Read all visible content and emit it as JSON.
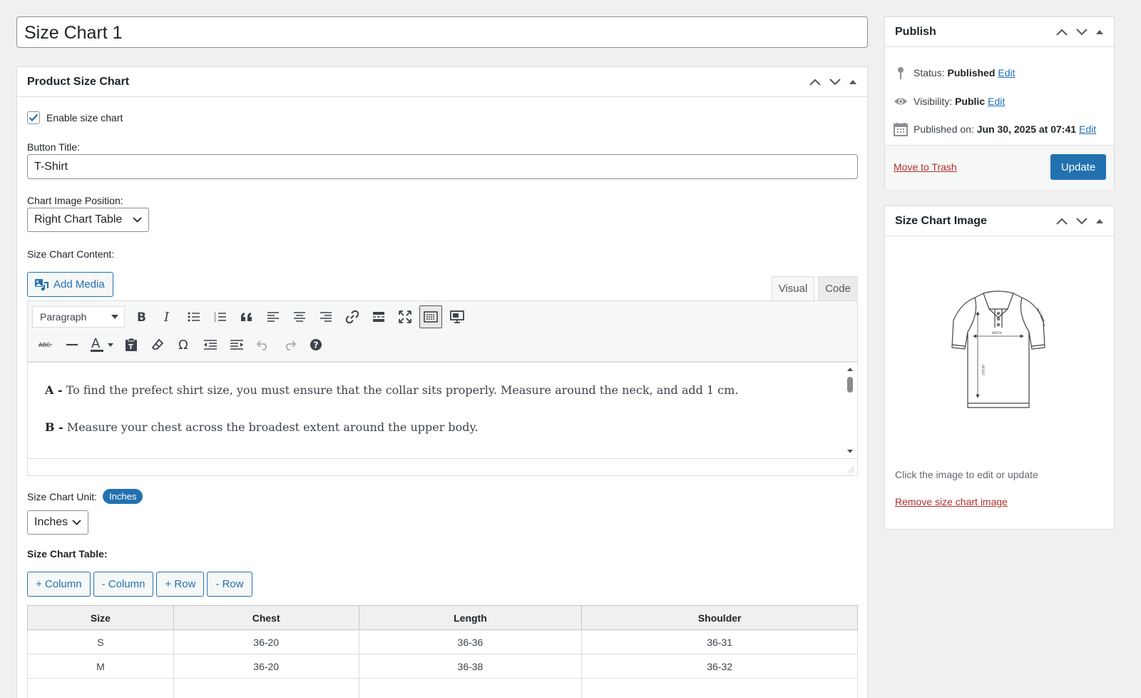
{
  "post_title": "Size Chart 1",
  "main_box": {
    "title": "Product Size Chart",
    "enable_label": "Enable size chart",
    "enable_checked": true,
    "button_title_label": "Button Title:",
    "button_title_value": "T-Shirt",
    "image_position_label": "Chart Image Position:",
    "image_position_value": "Right Chart Table",
    "content_label": "Size Chart Content:",
    "add_media_label": "Add Media",
    "tab_visual": "Visual",
    "tab_code": "Code",
    "format_select": "Paragraph",
    "content_paragraphs": [
      {
        "lead": "A -",
        "text": " To find the prefect shirt size, you must ensure that the collar sits properly. Measure around the neck, and add 1 cm."
      },
      {
        "lead": "B -",
        "text": " Measure your chest across the broadest extent around the upper body."
      }
    ],
    "unit_label": "Size Chart Unit:",
    "unit_badge": "Inches",
    "unit_select": "Inches",
    "table_label": "Size Chart Table:",
    "table_buttons": [
      "+ Column",
      "- Column",
      "+ Row",
      "- Row"
    ],
    "table": {
      "headers": [
        "Size",
        "Chest",
        "Length",
        "Shoulder"
      ],
      "rows": [
        [
          "S",
          "36-20",
          "36-36",
          "36-31"
        ],
        [
          "M",
          "36-20",
          "36-38",
          "36-32"
        ],
        [
          "",
          "",
          "",
          ""
        ]
      ]
    }
  },
  "publish_box": {
    "title": "Publish",
    "status_label": "Status:",
    "status_value": "Published",
    "visibility_label": "Visibility:",
    "visibility_value": "Public",
    "published_label": "Published on:",
    "published_value": "Jun 30, 2025 at 07:41",
    "edit_link": "Edit",
    "trash_link": "Move to Trash",
    "update_button": "Update"
  },
  "image_box": {
    "title": "Size Chart Image",
    "hint": "Click the image to edit or update",
    "remove_link": "Remove size chart image"
  },
  "toolbar_icons": {
    "row1": [
      "bold-icon",
      "italic-icon",
      "bullet-list-icon",
      "numbered-list-icon",
      "blockquote-icon",
      "align-left-icon",
      "align-center-icon",
      "align-right-icon",
      "link-icon",
      "read-more-icon",
      "fullscreen-icon",
      "toolbar-toggle-icon",
      "preview-icon"
    ],
    "row2": [
      "strikethrough-icon",
      "horizontal-line-icon",
      "text-color-icon",
      "paste-text-icon",
      "clear-formatting-icon",
      "special-character-icon",
      "outdent-icon",
      "indent-icon",
      "undo-icon",
      "redo-icon",
      "help-icon"
    ]
  },
  "colors": {
    "accent": "#2271b1",
    "danger": "#b32d2e",
    "background": "#f0f0f1"
  }
}
